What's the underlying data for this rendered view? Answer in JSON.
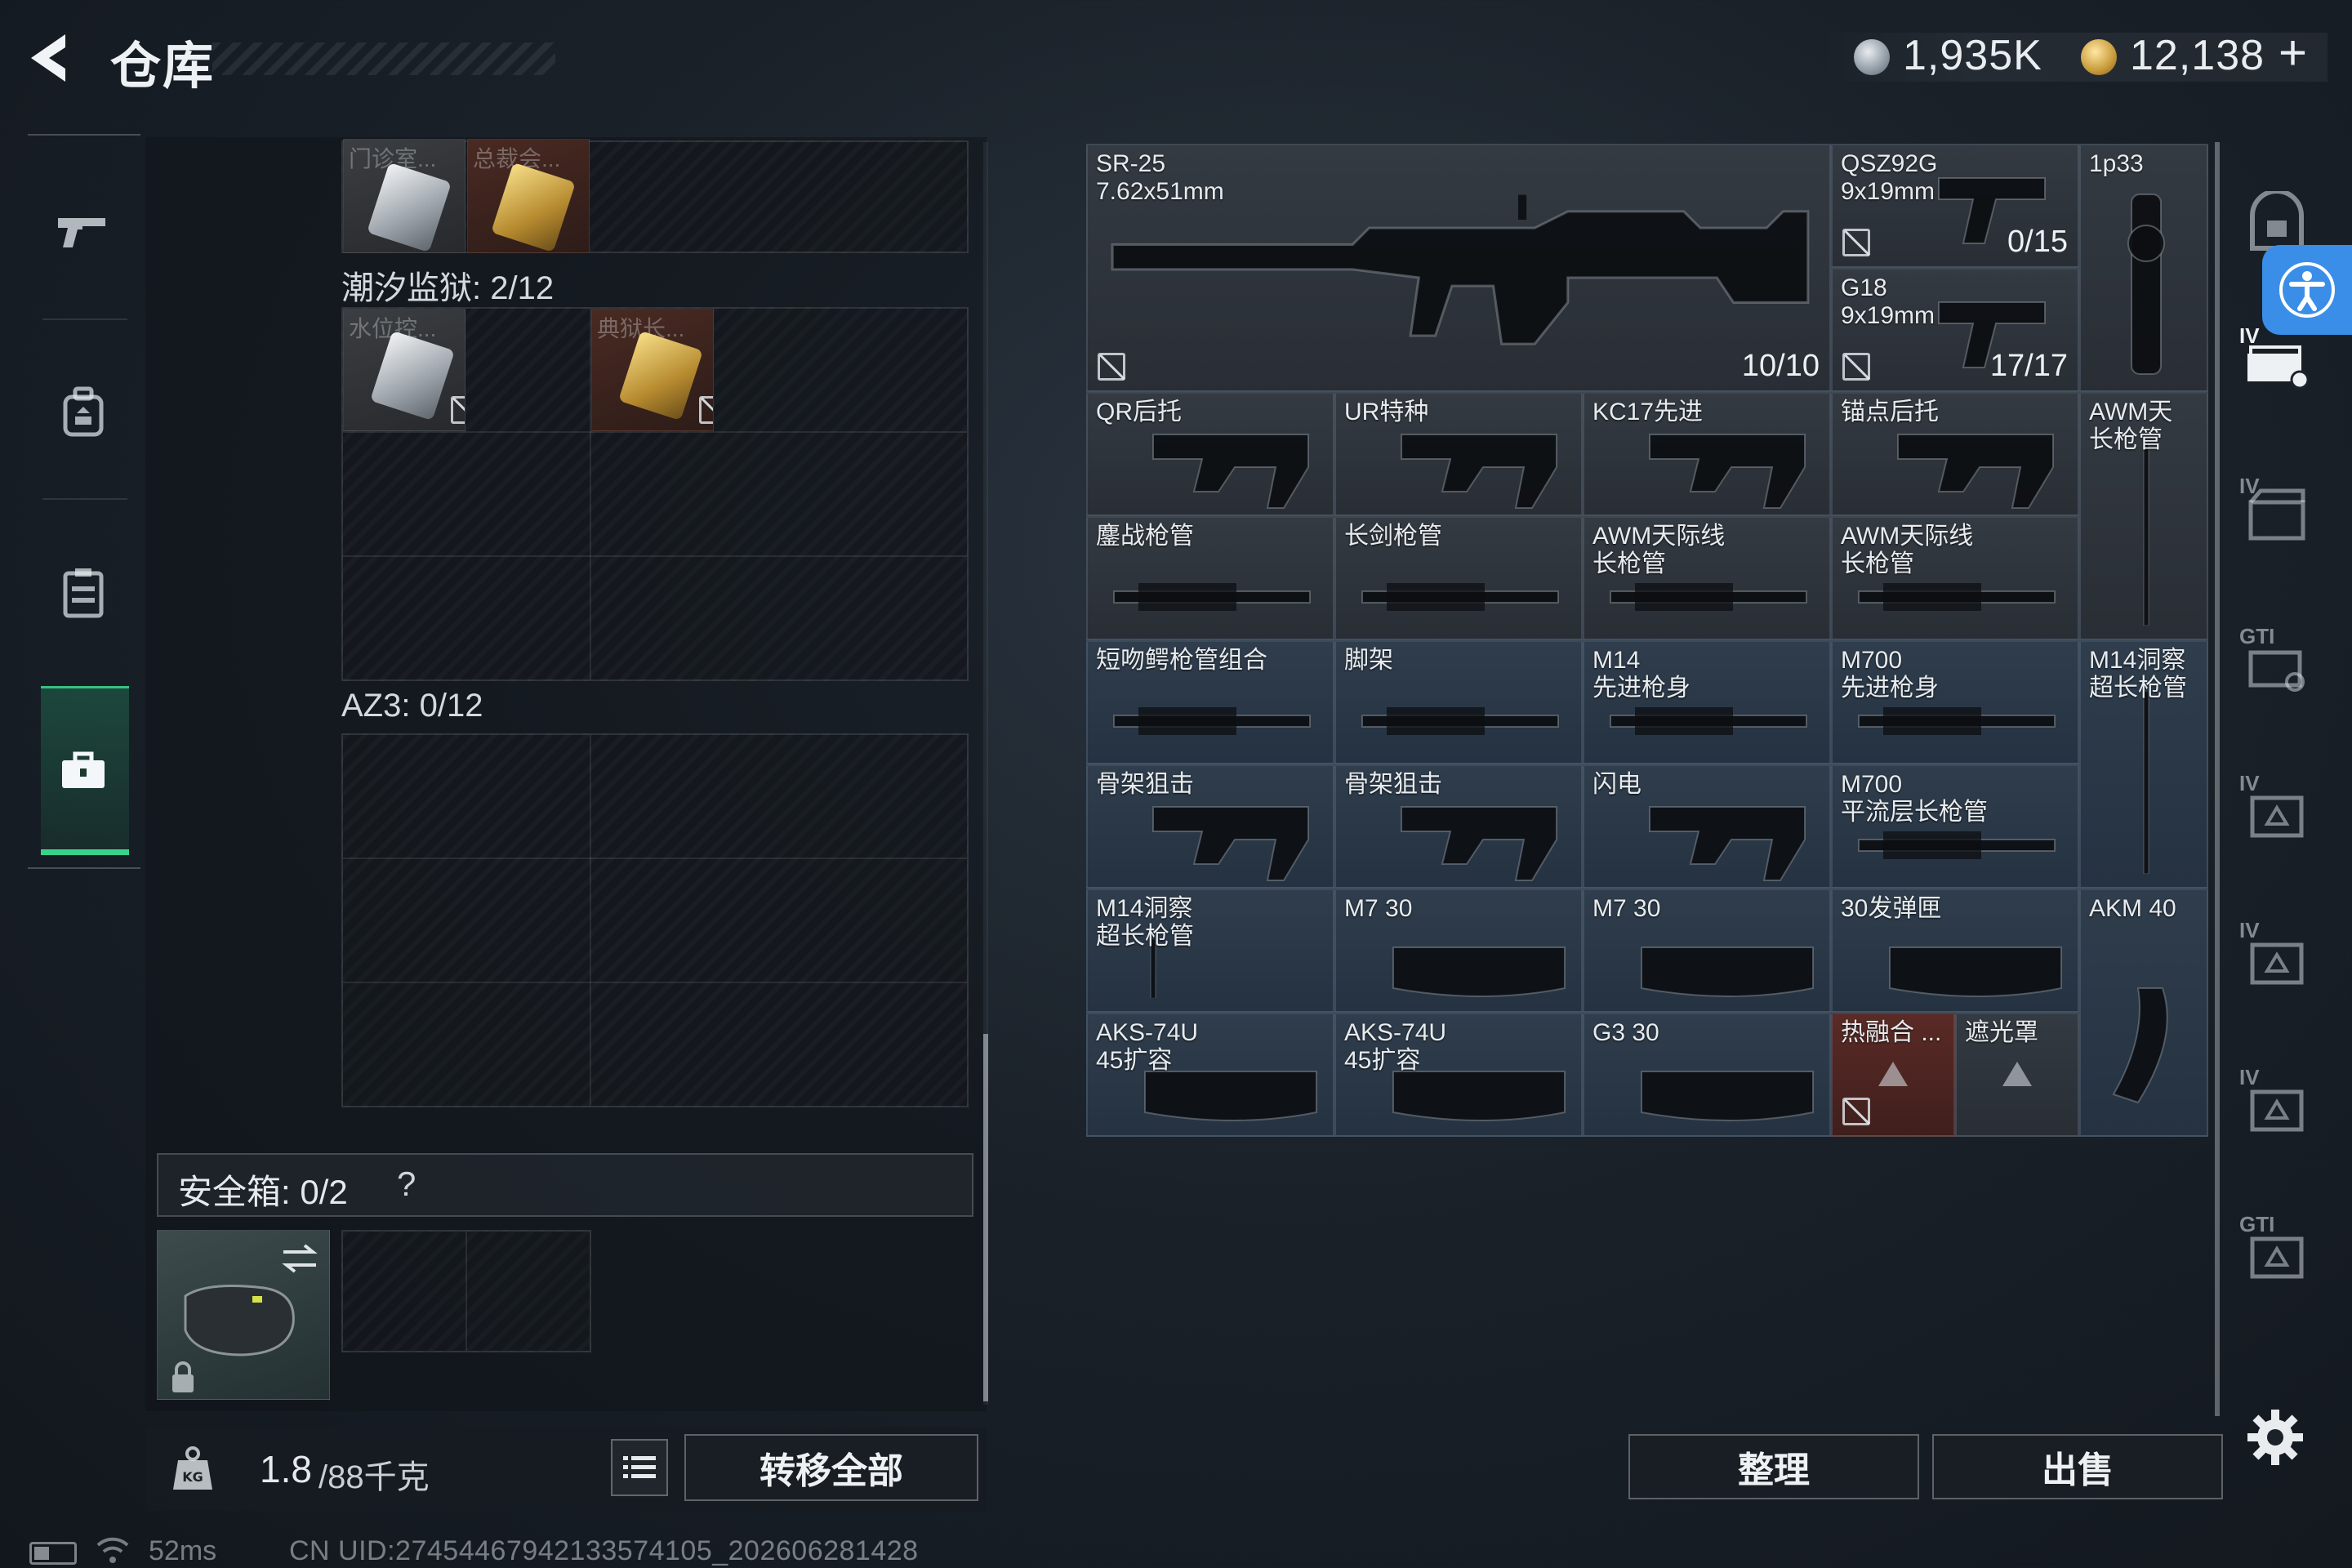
{
  "header": {
    "title": "仓库",
    "currency": [
      {
        "icon": "silver-coin-icon",
        "value": "1,935K"
      },
      {
        "icon": "gold-coin-icon",
        "value": "12,138"
      }
    ],
    "add_label": "+"
  },
  "left_nav": [
    {
      "icon": "gun-icon"
    },
    {
      "icon": "backpack-icon"
    },
    {
      "icon": "vest-icon"
    },
    {
      "icon": "briefcase-icon",
      "active": true
    }
  ],
  "left_panel": {
    "top_cards": [
      {
        "label": "门诊室...",
        "color": "gray"
      },
      {
        "label": "总裁会...",
        "color": "red"
      }
    ],
    "tide_prison": {
      "label": "潮汐监狱: 2/12",
      "cards": [
        {
          "label": "水位控...",
          "color": "gray",
          "locked_slot": true
        },
        {
          "label": "典狱长...",
          "color": "red",
          "locked_slot": true
        }
      ]
    },
    "az3": {
      "label": "AZ3: 0/12"
    },
    "safe_box": {
      "label": "安全箱: 0/2",
      "help": "?"
    },
    "weight": {
      "current": "1.8",
      "max": "/88千克"
    },
    "transfer_all": "转移全部"
  },
  "storage_items": [
    {
      "id": "sr25",
      "name": "SR-25\n7.62x51mm",
      "count": "10/10",
      "color": "gray"
    },
    {
      "id": "qsz92g",
      "name": "QSZ92G\n9x19mm",
      "count": "0/15",
      "color": "gray"
    },
    {
      "id": "g18",
      "name": "G18\n9x19mm",
      "count": "17/17",
      "color": "gray"
    },
    {
      "id": "1p33",
      "name": "1p33",
      "color": "gray"
    },
    {
      "id": "qr-stock",
      "name": "QR后托",
      "color": "gray"
    },
    {
      "id": "ur-stock",
      "name": "UR特种",
      "color": "gray"
    },
    {
      "id": "kc17-stock",
      "name": "KC17先进",
      "color": "gray"
    },
    {
      "id": "anchor-stock",
      "name": "锚点后托",
      "color": "gray"
    },
    {
      "id": "awm-long-1",
      "name": "AWM天\n长枪管",
      "color": "gray"
    },
    {
      "id": "melee-barrel",
      "name": "鏖战枪管",
      "color": "gray"
    },
    {
      "id": "longsword-barrel",
      "name": "长剑枪管",
      "color": "gray"
    },
    {
      "id": "awm-horizon-1",
      "name": "AWM天际线\n长枪管",
      "color": "gray"
    },
    {
      "id": "awm-horizon-2",
      "name": "AWM天际线\n长枪管",
      "color": "gray"
    },
    {
      "id": "short-kiss",
      "name": "短吻鳄枪管组合",
      "color": "blue"
    },
    {
      "id": "bipod",
      "name": "脚架",
      "color": "blue"
    },
    {
      "id": "m14-body",
      "name": "M14\n先进枪身",
      "color": "blue"
    },
    {
      "id": "m700-body",
      "name": "M700\n先进枪身",
      "color": "blue"
    },
    {
      "id": "m14-cave-1",
      "name": "M14洞察\n超长枪管",
      "color": "blue"
    },
    {
      "id": "skeleton-1",
      "name": "骨架狙击",
      "color": "blue"
    },
    {
      "id": "skeleton-2",
      "name": "骨架狙击",
      "color": "blue"
    },
    {
      "id": "lightning",
      "name": "闪电",
      "color": "blue"
    },
    {
      "id": "m700-laminar",
      "name": "M700\n平流层长枪管",
      "color": "blue"
    },
    {
      "id": "m14-cave-2",
      "name": "M14洞察\n超长枪管",
      "color": "blue"
    },
    {
      "id": "m7-30-a",
      "name": "M7 30",
      "color": "blue"
    },
    {
      "id": "m7-30-b",
      "name": "M7 30",
      "color": "blue"
    },
    {
      "id": "mag30",
      "name": "30发弹匣",
      "color": "blue"
    },
    {
      "id": "akm40",
      "name": "AKM 40",
      "color": "blue"
    },
    {
      "id": "aks-a",
      "name": "AKS-74U\n45扩容",
      "color": "blue"
    },
    {
      "id": "aks-b",
      "name": "AKS-74U\n45扩容",
      "color": "blue"
    },
    {
      "id": "g3-30",
      "name": "G3 30",
      "color": "blue"
    },
    {
      "id": "thermal",
      "name": "热融合 ...",
      "color": "red"
    },
    {
      "id": "shade",
      "name": "遮光罩",
      "color": "gray"
    }
  ],
  "right_tabs": [
    {
      "icon": "safe-icon",
      "tag": ""
    },
    {
      "icon": "ammo-box-icon",
      "tag": "IV"
    },
    {
      "icon": "crate-icon",
      "tag": "IV"
    },
    {
      "icon": "tool-case-icon",
      "tag": "GTI"
    },
    {
      "icon": "supply-case-icon",
      "tag": "IV"
    },
    {
      "icon": "supply-case-icon",
      "tag": "IV"
    },
    {
      "icon": "supply-case-icon",
      "tag": "IV"
    },
    {
      "icon": "supply-case-icon",
      "tag": "GTI"
    }
  ],
  "buttons": {
    "tidy": "整理",
    "sell": "出售"
  },
  "status": {
    "ping": "52ms",
    "uid": "CN UID:274544679421335741​05_202606281428"
  },
  "colors": {
    "accent_green": "#39d28a",
    "item_blue": "#2c3a49",
    "item_red": "#552824",
    "accessibility_blue": "#3a8ee8"
  }
}
